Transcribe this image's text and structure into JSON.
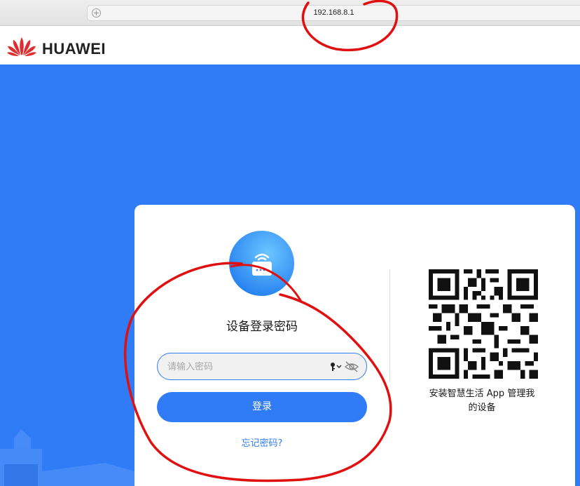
{
  "browser": {
    "url": "192.168.8.1",
    "address_icon": "plus-circle-icon"
  },
  "header": {
    "brand": "HUAWEI",
    "logo_icon": "huawei-petal-logo",
    "logo_color": "#e02c2c"
  },
  "login": {
    "router_icon": "wifi-router-icon",
    "title": "设备登录密码",
    "password_placeholder": "请输入密码",
    "password_value": "",
    "key_icon": "key-dropdown-icon",
    "visibility_icon": "eye-hidden-icon",
    "login_button": "登录",
    "forgot_link": "忘记密码?"
  },
  "qr": {
    "caption_line1": "安装智慧生活 App 管理我",
    "caption_line2": "的设备"
  },
  "colors": {
    "accent": "#2f7cf6",
    "background_blue": "#2f7cf6",
    "annotation_red": "#e01010"
  }
}
